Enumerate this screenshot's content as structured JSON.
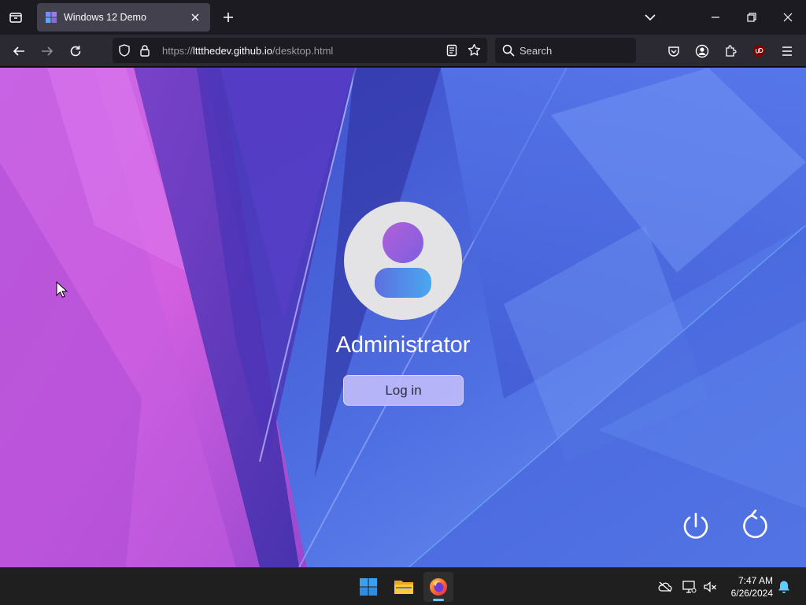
{
  "browser": {
    "tab_title": "Windows 12 Demo",
    "url_scheme": "https://",
    "url_host": "lttthedev.github.io",
    "url_path": "/desktop.html",
    "search_placeholder": "Search"
  },
  "lockscreen": {
    "username": "Administrator",
    "login_label": "Log in"
  },
  "taskbar": {
    "apps": [
      "start",
      "file-explorer",
      "firefox"
    ],
    "time": "7:47 AM",
    "date": "6/26/2024"
  },
  "colors": {
    "chrome_dark": "#1c1b22",
    "toolbar": "#2b2a33",
    "login_button": "#c4befa",
    "taskbar": "#1f1f1f",
    "accent": "#60cdff"
  }
}
